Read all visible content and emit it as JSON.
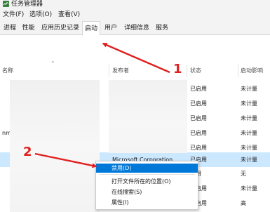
{
  "window": {
    "title": "任务管理器",
    "icon": "task-manager-icon"
  },
  "menu": {
    "items": [
      "文件(F)",
      "选项(O)",
      "查看(V)"
    ]
  },
  "tabs": [
    {
      "label": "进程",
      "active": false
    },
    {
      "label": "性能",
      "active": false
    },
    {
      "label": "应用历史记录",
      "active": false
    },
    {
      "label": "启动",
      "active": true
    },
    {
      "label": "用户",
      "active": false
    },
    {
      "label": "详细信息",
      "active": false
    },
    {
      "label": "服务",
      "active": false
    }
  ],
  "columns": {
    "name": "名称",
    "publisher": "发布者",
    "status": "状态",
    "impact": "启动影响"
  },
  "rows": [
    {
      "name": "",
      "publisher": "",
      "status": "已启用",
      "impact": "未计量"
    },
    {
      "name": "",
      "publisher": "",
      "status": "已启用",
      "impact": "未计量"
    },
    {
      "name": "",
      "publisher": "",
      "status": "已启用",
      "impact": "未计量"
    },
    {
      "name": "nman...",
      "publisher": "",
      "status": "已启用",
      "impact": "未计量"
    },
    {
      "name": "",
      "publisher": "",
      "status": "已启用",
      "impact": "未计量"
    },
    {
      "name": "",
      "publisher": "Microsoft Corporation",
      "status": "已启用",
      "impact": "未计量"
    },
    {
      "name": "",
      "publisher": "",
      "status": "禁用",
      "impact": "无"
    },
    {
      "name": "",
      "publisher": "",
      "status": "已启用",
      "impact": "未计量"
    },
    {
      "name": "",
      "publisher": "",
      "status": "已启用",
      "impact": "高"
    }
  ],
  "context_menu": {
    "items": [
      {
        "label": "禁用(D)"
      },
      {
        "label": "打开文件所在的位置(O)"
      },
      {
        "label": "在线搜索(S)"
      },
      {
        "label": "属性(I)"
      }
    ]
  },
  "annotations": {
    "marker1": "1",
    "marker2": "2",
    "color": "#e02020"
  },
  "colors": {
    "selection": "#cce8ff",
    "menu_highlight": "#0078d7"
  }
}
